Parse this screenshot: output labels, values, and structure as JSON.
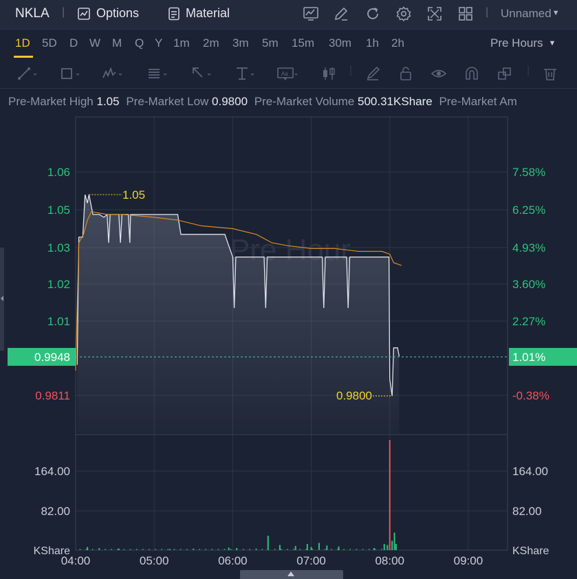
{
  "header": {
    "symbol": "NKLA",
    "options_label": "Options",
    "material_label": "Material",
    "layout_name": "Unnamed",
    "icons": [
      "chart-icon",
      "edit-icon",
      "refresh-icon",
      "settings-icon",
      "fullscreen-icon",
      "grid-icon"
    ]
  },
  "timeframes": {
    "items": [
      "1D",
      "5D",
      "D",
      "W",
      "M",
      "Q",
      "Y",
      "1m",
      "2m",
      "3m",
      "5m",
      "15m",
      "30m",
      "1h",
      "2h"
    ],
    "active": "1D",
    "session_label": "Pre Hours"
  },
  "drawing_tools": [
    "line-tool-icon",
    "rectangle-tool-icon",
    "wave-tool-icon",
    "fib-tool-icon",
    "arrow-tool-icon",
    "text-tool-icon",
    "annotation-tool-icon",
    "candle-tool-icon",
    "brush-icon",
    "lock-icon",
    "eye-icon",
    "magnet-icon",
    "layers-icon",
    "trash-icon"
  ],
  "stats": {
    "high_label": "Pre-Market High",
    "high_value": "1.05",
    "low_label": "Pre-Market Low",
    "low_value": "0.9800",
    "volume_label": "Pre-Market Volume",
    "volume_value": "500.31KShare",
    "amount_label": "Pre-Market Am"
  },
  "colors": {
    "background": "#1b2233",
    "price_line": "#dfe3ea",
    "avg_line": "#d98b24",
    "up": "#2ec27e",
    "down": "#f0545d",
    "marker": "#f5d32a",
    "grid": "#2d3547"
  },
  "chart_data": {
    "type": "line",
    "watermark": "Pre Hour",
    "x_ticks": [
      "04:00",
      "05:00",
      "06:00",
      "07:00",
      "08:00",
      "09:00"
    ],
    "price_axis_ticks": [
      "1.06",
      "1.05",
      "1.03",
      "1.02",
      "1.01"
    ],
    "pct_axis_ticks": [
      "7.58%",
      "6.25%",
      "4.93%",
      "3.60%",
      "2.27%"
    ],
    "current_price": "0.9948",
    "current_pct": "1.01%",
    "reference_price": "0.9811",
    "reference_pct": "-0.38%",
    "high_marker": "1.05",
    "low_marker": "0.9800",
    "price_range": [
      0.975,
      1.072
    ],
    "volume_axis_ticks": [
      "164.00",
      "82.00"
    ],
    "volume_unit": "KShare",
    "volume_range": [
      0,
      214
    ],
    "price_series": [
      [
        4.02,
        0.992
      ],
      [
        4.04,
        1.037
      ],
      [
        4.09,
        1.037
      ],
      [
        4.12,
        1.052
      ],
      [
        4.15,
        1.049
      ],
      [
        4.17,
        1.052
      ],
      [
        4.22,
        1.045
      ],
      [
        4.3,
        1.045
      ],
      [
        4.36,
        1.044
      ],
      [
        4.4,
        1.045
      ],
      [
        4.45,
        1.045
      ],
      [
        4.5,
        1.045
      ],
      [
        4.55,
        1.045
      ],
      [
        4.62,
        1.045
      ],
      [
        4.7,
        1.045
      ],
      [
        4.8,
        1.045
      ],
      [
        4.9,
        1.045
      ],
      [
        5.0,
        1.045
      ],
      [
        5.1,
        1.045
      ],
      [
        5.2,
        1.045
      ],
      [
        5.3,
        1.045
      ],
      [
        5.34,
        1.038
      ],
      [
        5.5,
        1.038
      ],
      [
        5.7,
        1.038
      ],
      [
        5.9,
        1.038
      ],
      [
        6.0,
        1.03
      ],
      [
        6.1,
        1.03
      ],
      [
        6.3,
        1.03
      ],
      [
        6.55,
        1.03
      ],
      [
        6.7,
        1.03
      ],
      [
        6.9,
        1.03
      ],
      [
        7.1,
        1.03
      ],
      [
        7.3,
        1.03
      ],
      [
        7.5,
        1.03
      ],
      [
        7.7,
        1.03
      ],
      [
        7.9,
        1.03
      ],
      [
        7.99,
        1.03
      ],
      [
        8.0,
        0.987
      ],
      [
        8.03,
        0.981
      ],
      [
        8.05,
        0.998
      ],
      [
        8.1,
        0.998
      ],
      [
        8.12,
        0.995
      ]
    ],
    "avg_series": [
      [
        4.0,
        0.99
      ],
      [
        4.04,
        1.035
      ],
      [
        4.1,
        1.038
      ],
      [
        4.15,
        1.043
      ],
      [
        4.2,
        1.046
      ],
      [
        4.4,
        1.045
      ],
      [
        4.6,
        1.045
      ],
      [
        5.0,
        1.044
      ],
      [
        5.3,
        1.043
      ],
      [
        5.6,
        1.041
      ],
      [
        6.0,
        1.04
      ],
      [
        6.3,
        1.038
      ],
      [
        6.5,
        1.035
      ],
      [
        6.7,
        1.034
      ],
      [
        7.0,
        1.033
      ],
      [
        7.3,
        1.033
      ],
      [
        7.6,
        1.032
      ],
      [
        7.9,
        1.032
      ],
      [
        8.0,
        1.031
      ],
      [
        8.05,
        1.028
      ],
      [
        8.15,
        1.027
      ]
    ],
    "volume_series": [
      [
        4.15,
        6,
        "up"
      ],
      [
        4.3,
        4,
        "up"
      ],
      [
        4.55,
        3,
        "up"
      ],
      [
        5.2,
        2,
        "up"
      ],
      [
        5.5,
        3,
        "up"
      ],
      [
        5.95,
        5,
        "up"
      ],
      [
        6.05,
        4,
        "up"
      ],
      [
        6.3,
        3,
        "up"
      ],
      [
        6.45,
        28,
        "up"
      ],
      [
        6.6,
        10,
        "up"
      ],
      [
        6.8,
        8,
        "up"
      ],
      [
        6.95,
        12,
        "up"
      ],
      [
        7.0,
        6,
        "up"
      ],
      [
        7.1,
        14,
        "up"
      ],
      [
        7.2,
        9,
        "up"
      ],
      [
        7.35,
        7,
        "up"
      ],
      [
        7.8,
        4,
        "up"
      ],
      [
        7.93,
        12,
        "up"
      ],
      [
        7.97,
        10,
        "up"
      ],
      [
        8.0,
        214,
        "down"
      ],
      [
        8.03,
        18,
        "up"
      ],
      [
        8.06,
        34,
        "up"
      ],
      [
        8.08,
        12,
        "up"
      ]
    ]
  }
}
